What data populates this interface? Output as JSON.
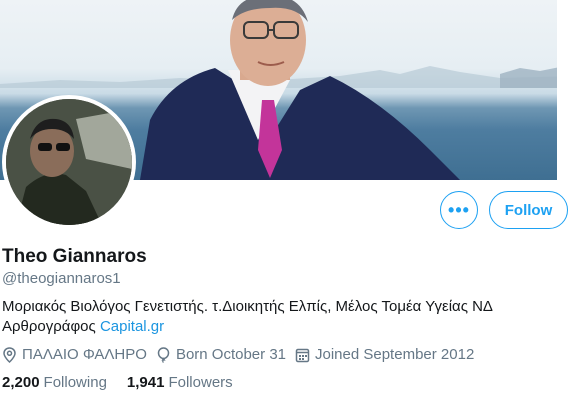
{
  "profile": {
    "name": "Theo Giannaros",
    "handle": "@theogiannaros1",
    "bio_text": "Μοριακός Βιολόγος Γενετιστής. τ.Διοικητής Ελπίς, Μέλος Τομέα Υγείας ΝΔ Αρθρογράφος ",
    "bio_link": "Capital.gr",
    "location": "ΠΑΛΑΙΟ ΦΑΛΗΡΟ",
    "birthday": "Born October 31",
    "joined": "Joined September 2012"
  },
  "stats": {
    "following_count": "2,200",
    "following_label": "Following",
    "followers_count": "1,941",
    "followers_label": "Followers"
  },
  "actions": {
    "more_label": "•••",
    "follow_label": "Follow"
  },
  "colors": {
    "accent": "#1da1f2",
    "secondary_text": "#657786",
    "primary_text": "#14171a"
  },
  "icons": [
    "more-options-icon",
    "location-pin-icon",
    "birthday-balloon-icon",
    "calendar-icon"
  ]
}
